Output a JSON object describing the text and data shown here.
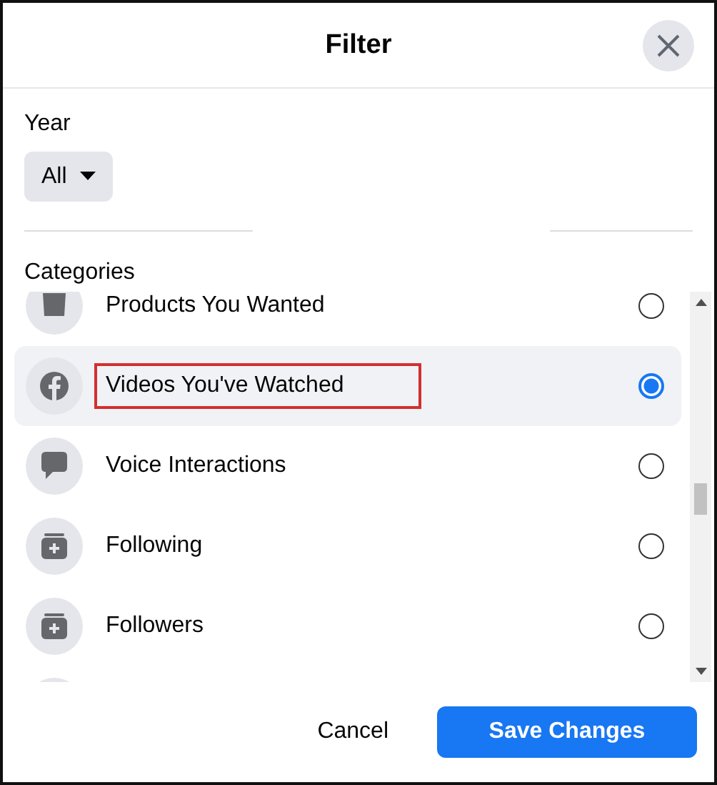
{
  "dialog": {
    "title": "Filter"
  },
  "year": {
    "label": "Year",
    "value": "All"
  },
  "categories": {
    "label": "Categories",
    "items": [
      {
        "label": "Products You Wanted",
        "kind": "bag",
        "selected": false,
        "highlighted": false
      },
      {
        "label": "Videos You've Watched",
        "kind": "facebook",
        "selected": true,
        "highlighted": true
      },
      {
        "label": "Voice Interactions",
        "kind": "chat",
        "selected": false,
        "highlighted": false
      },
      {
        "label": "Following",
        "kind": "plus-box",
        "selected": false,
        "highlighted": false
      },
      {
        "label": "Followers",
        "kind": "plus-box",
        "selected": false,
        "highlighted": false
      },
      {
        "kind": "blank"
      }
    ]
  },
  "buttons": [
    {
      "label": "Cancel",
      "kind": "secondary"
    },
    {
      "label": "Save Changes",
      "kind": "primary"
    }
  ]
}
